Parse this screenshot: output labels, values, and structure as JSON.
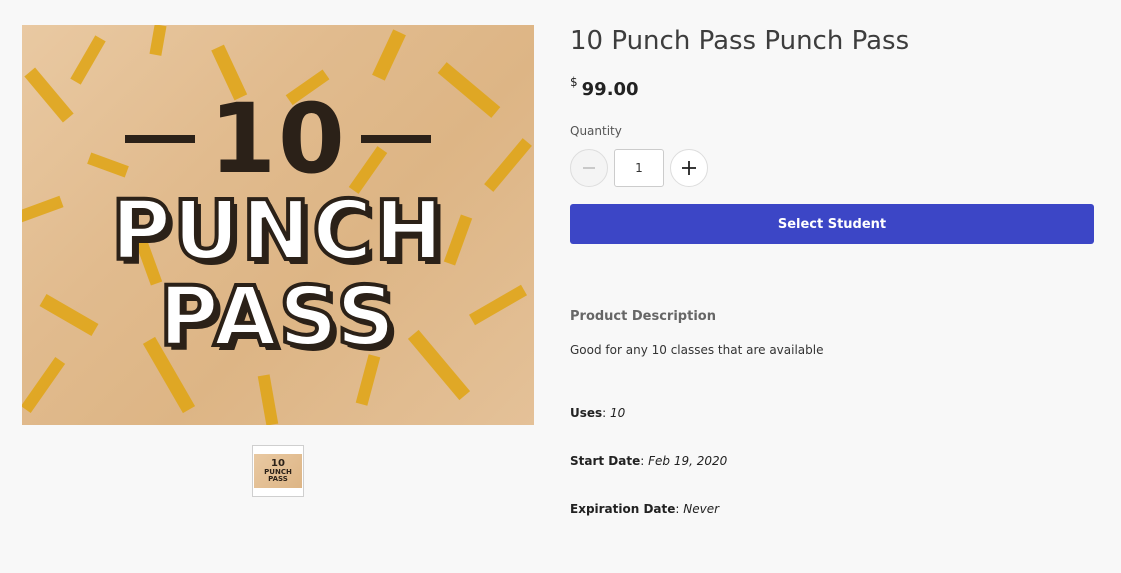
{
  "product": {
    "title": "10 Punch Pass Punch Pass",
    "currency_symbol": "$",
    "price": "99.00",
    "image": {
      "line1": "10",
      "line2": "PUNCH",
      "line3": "PASS"
    }
  },
  "quantity": {
    "label": "Quantity",
    "value": "1",
    "decrement_icon": "minus-icon",
    "increment_icon": "plus-icon"
  },
  "actions": {
    "select_student_label": "Select Student",
    "accent_color": "#3c46c6"
  },
  "description": {
    "heading": "Product Description",
    "text": "Good for any 10 classes that are available"
  },
  "attributes": {
    "uses_label": "Uses",
    "uses_value": "10",
    "start_label": "Start Date",
    "start_value": "Feb 19, 2020",
    "expiration_label": "Expiration Date",
    "expiration_value": "Never"
  }
}
